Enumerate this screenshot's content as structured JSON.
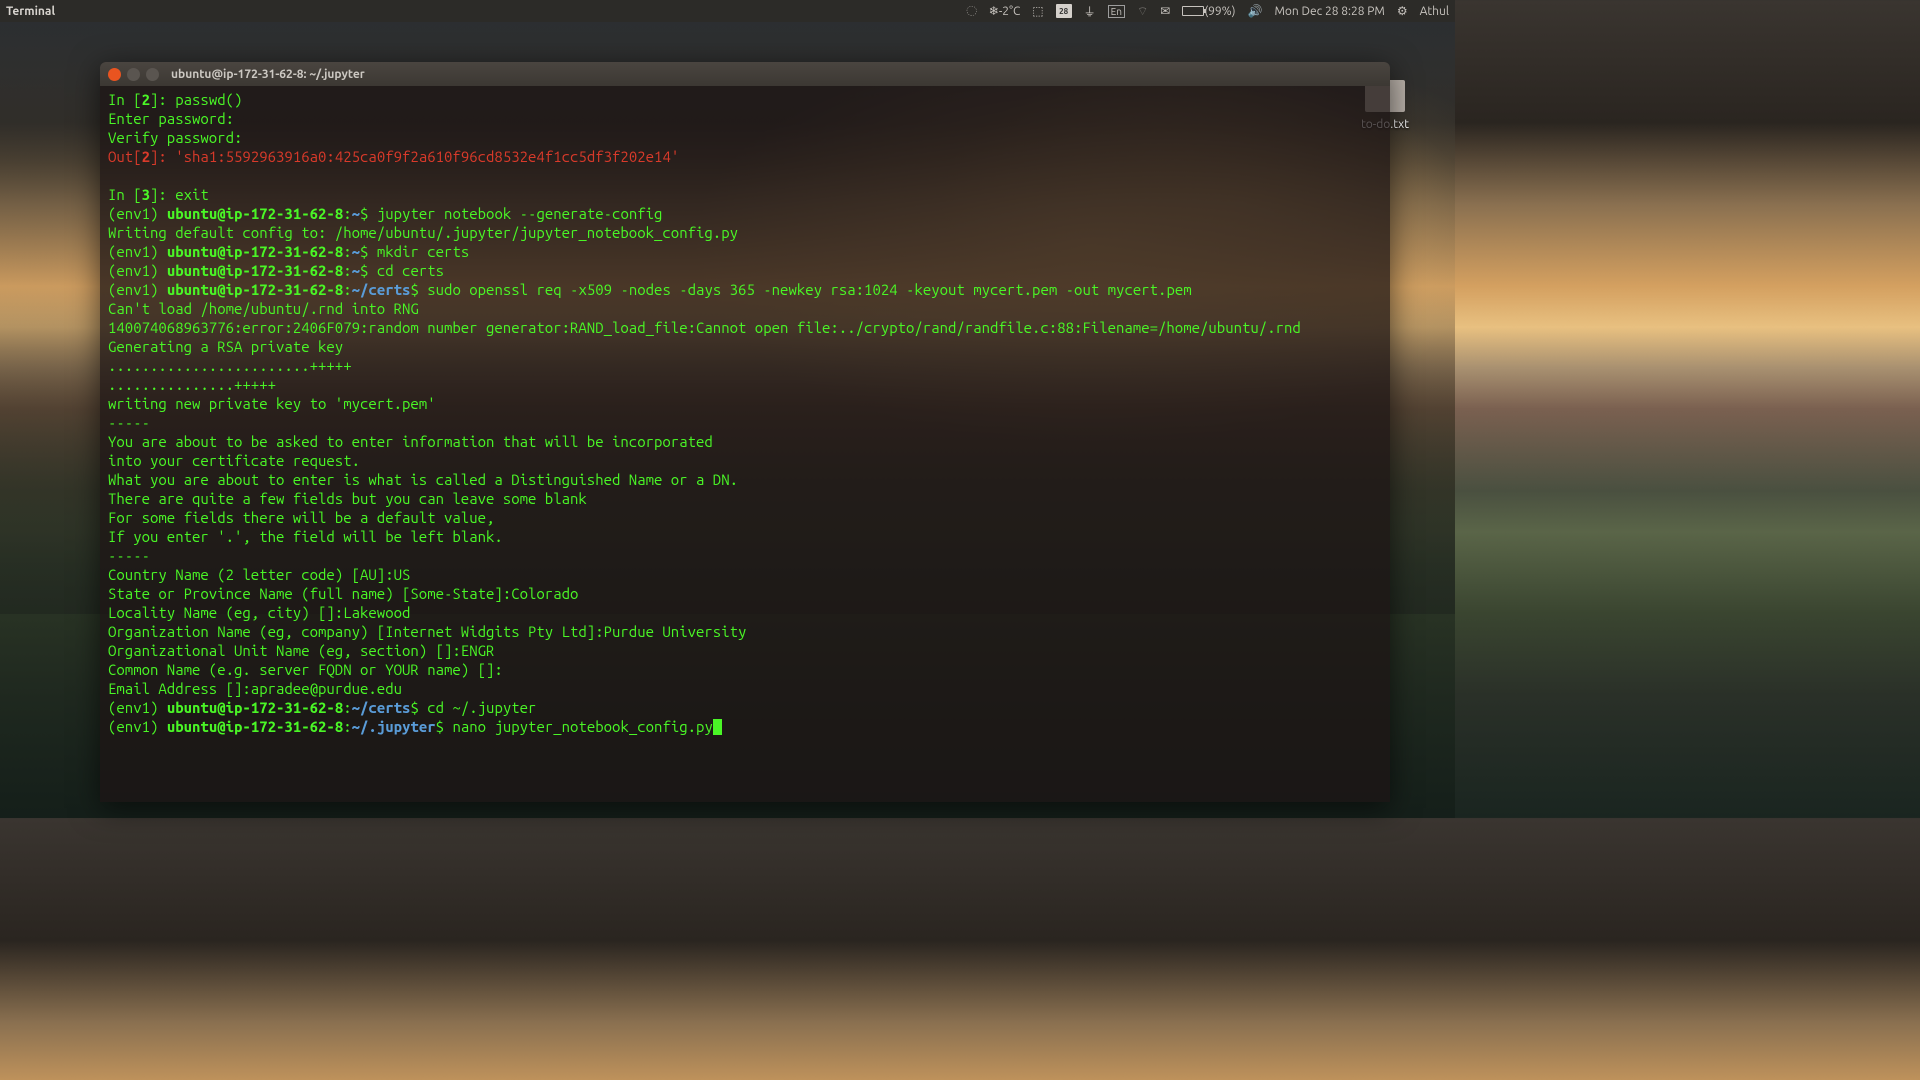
{
  "menubar": {
    "app_name": "Terminal",
    "weather": "-2°C",
    "calendar_day": "28",
    "keyboard": "En",
    "battery": "(99%)",
    "datetime": "Mon Dec 28  8:28 PM",
    "user": "Athul"
  },
  "desktop": {
    "file_label": "to-do.txt"
  },
  "window": {
    "title": "ubuntu@ip-172-31-62-8: ~/.jupyter"
  },
  "term": {
    "in2_prompt": "In [",
    "in2_num": "2",
    "in2_suffix": "]: ",
    "in2_cmd": "passwd()",
    "enter_pw": "Enter password:",
    "verify_pw": "Verify password:",
    "out2_prompt": "Out[",
    "out2_num": "2",
    "out2_suffix": "]:",
    "out2_val": "'sha1:5592963916a0:425ca0f9f2a610f96cd8532e4f1cc5df3f202e14'",
    "in3_prompt": "In [",
    "in3_num": "3",
    "in3_suffix": "]: ",
    "in3_cmd": "exit",
    "env_prefix": "(env1) ",
    "host_home": "ubuntu@ip-172-31-62-8",
    "path_home": "~",
    "path_certs": "~/certs",
    "path_jupyter": "~/.jupyter",
    "dollar": "$ ",
    "colon": ":",
    "cmd_genconfig": "jupyter notebook --generate-config",
    "writing_config": "Writing default config to: /home/ubuntu/.jupyter/jupyter_notebook_config.py",
    "cmd_mkdir": "mkdir certs",
    "cmd_cdcerts": "cd certs",
    "cmd_openssl": "sudo openssl req -x509 -nodes -days 365 -newkey rsa:1024 -keyout mycert.pem -out mycert.pem",
    "err_rnd": "Can't load /home/ubuntu/.rnd into RNG",
    "err_randfile": "140074068963776:error:2406F079:random number generator:RAND_load_file:Cannot open file:../crypto/rand/randfile.c:88:Filename=/home/ubuntu/.rnd",
    "gen_rsa": "Generating a RSA private key",
    "dots1": "........................+++++",
    "dots2": "...............+++++",
    "writing_key": "writing new private key to 'mycert.pem'",
    "dashes": "-----",
    "dn1": "You are about to be asked to enter information that will be incorporated",
    "dn2": "into your certificate request.",
    "dn3": "What you are about to enter is what is called a Distinguished Name or a DN.",
    "dn4": "There are quite a few fields but you can leave some blank",
    "dn5": "For some fields there will be a default value,",
    "dn6": "If you enter '.', the field will be left blank.",
    "country": "Country Name (2 letter code) [AU]:US",
    "state": "State or Province Name (full name) [Some-State]:Colorado",
    "locality": "Locality Name (eg, city) []:Lakewood",
    "org": "Organization Name (eg, company) [Internet Widgits Pty Ltd]:Purdue University",
    "orgunit": "Organizational Unit Name (eg, section) []:ENGR",
    "common": "Common Name (e.g. server FQDN or YOUR name) []:",
    "email": "Email Address []:apradee@purdue.edu",
    "cmd_cdjup": "cd ~/.jupyter",
    "cmd_nano": "nano jupyter_notebook_config.py"
  }
}
